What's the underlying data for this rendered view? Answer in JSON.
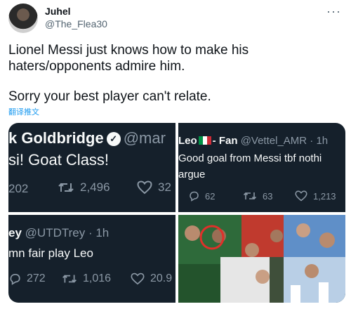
{
  "author": {
    "name": "Juhel",
    "handle": "@The_Flea30",
    "more_icon": "more-horizontal-icon"
  },
  "tweet": {
    "line1": "Lionel Messi just knows how to make his",
    "line2": "haters/opponents admire him.",
    "line3": "Sorry your best player can't relate.",
    "translate_label": "翻译推文"
  },
  "screenshots": [
    {
      "name": "k Goldbridge",
      "handle": "@mar",
      "text": "si! Goat Class!",
      "replies": "202",
      "retweets": "2,496",
      "likes": "32"
    },
    {
      "name": "Leo",
      "name_suffix": "- Fan",
      "handle": "@Vettel_AMR · 1h",
      "text_line1": "Good goal from Messi tbf nothi",
      "text_line2": "argue",
      "replies": "62",
      "retweets": "63",
      "likes": "1,213"
    },
    {
      "name": "ey",
      "handle": "@UTDTrey · 1h",
      "text": "mn fair play Leo",
      "replies": "272",
      "retweets": "1,016",
      "likes": "20.9"
    }
  ],
  "colors": {
    "dark_bg": "#15202b",
    "text_light": "#f7f9f9",
    "muted": "#8b98a5",
    "link": "#1d9bf0"
  }
}
